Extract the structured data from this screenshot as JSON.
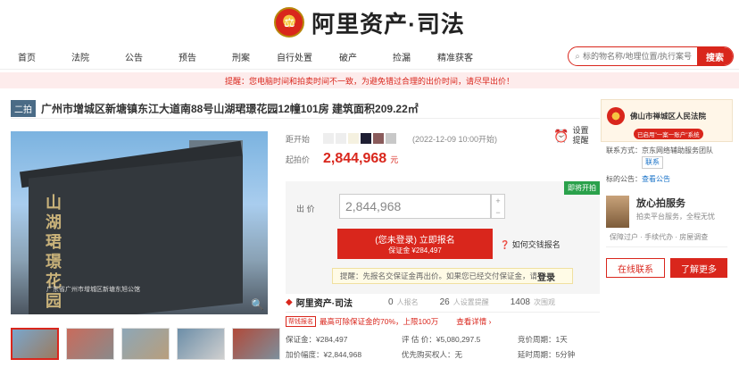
{
  "header": {
    "brand": "阿里资产·司法"
  },
  "nav": [
    "首页",
    "法院",
    "公告",
    "预告",
    "刑案",
    "自行处置",
    "破产",
    "捡漏",
    "精准获客"
  ],
  "search": {
    "placeholder": "标的物名称/地理位置/执行案号",
    "button": "搜索"
  },
  "notice": "提醒：您电脑时间和拍卖时间不一致，为避免错过合理的出价时间，请尽早出价！",
  "listing": {
    "round": "二拍",
    "title": "广州市增城区新塘镇东江大道南88号山湖珺璟花园12幢101房 建筑面积209.22㎡",
    "photo_letters": "山湖珺璟花园",
    "photo_caption": "广东省广州市增城区新塘东旭公馆",
    "start_label": "距开始",
    "start_time": "(2022-12-09 10:00开始)",
    "set_reminder": "设置提醒",
    "start_price_label": "起拍价",
    "start_price": "2,844,968",
    "yuan": "元",
    "badge_ready": "即将开拍",
    "bid_label": "出 价",
    "bid_value": "2,844,968",
    "signup_main": "(您未登录) 立即报名",
    "signup_sub": "保证金 ¥284,497",
    "howto": "如何交钱报名",
    "tip": "提醒：先报名交保证金再出价。如果您已经交付保证金，请",
    "tip_login": "登录"
  },
  "stats": {
    "brand": "阿里资产·司法",
    "viewers": "0",
    "viewers_label": "人报名",
    "reminders": "26",
    "reminders_label": "人设置提醒",
    "views": "1408",
    "views_label": "次围观"
  },
  "loan": {
    "badge": "帮钱报名",
    "text": "最高可除保证金的70%，上限100万",
    "more": "查看详情 ›"
  },
  "details": [
    "保证金：¥284,497",
    "评 估 价：¥5,080,297.5",
    "竞价周期：1天",
    "加价幅度：¥2,844,968",
    "优先购买权人：无",
    "延时周期：5分钟"
  ],
  "court": {
    "name": "佛山市禅城区人民法院",
    "tag": "已启用\"一案一账户\"系统",
    "contact_label": "联系方式：京东网络辅助服务团队",
    "contact_btn": "联系",
    "announce_label": "标的公告：",
    "announce_link": "查看公告"
  },
  "service": {
    "h": "放心拍服务",
    "d": "拍卖平台服务，全程无忧",
    "f": "保障过户 · 手续代办 · 房屋调查"
  },
  "buttons": {
    "online": "在线联系",
    "more": "了解更多"
  }
}
